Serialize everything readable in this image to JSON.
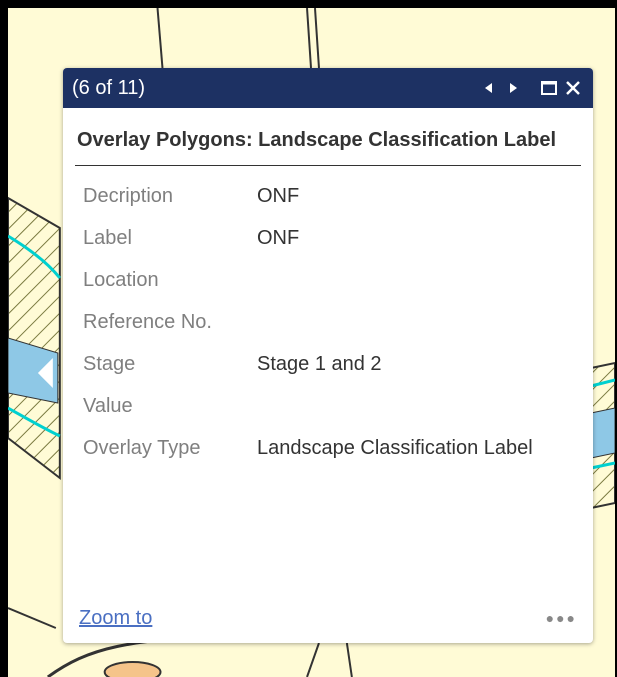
{
  "popup": {
    "counter": "(6 of 11)",
    "title": "Overlay Polygons: Landscape Classification Label",
    "attributes": [
      {
        "key": "Decription",
        "value": "ONF"
      },
      {
        "key": "Label",
        "value": "ONF"
      },
      {
        "key": "Location",
        "value": ""
      },
      {
        "key": "Reference No.",
        "value": ""
      },
      {
        "key": "Stage",
        "value": "Stage 1 and 2"
      },
      {
        "key": "Value",
        "value": ""
      },
      {
        "key": "Overlay Type",
        "value": "Landscape Classification Label"
      }
    ],
    "zoom_label": "Zoom to",
    "more_label": "●●●"
  },
  "icons": {
    "prev": "previous-arrow-icon",
    "next": "next-arrow-icon",
    "maximize": "maximize-icon",
    "close": "close-icon"
  },
  "colors": {
    "header_bg": "#1d3163",
    "map_bg": "#fffbd6",
    "link": "#4a6fc2"
  }
}
